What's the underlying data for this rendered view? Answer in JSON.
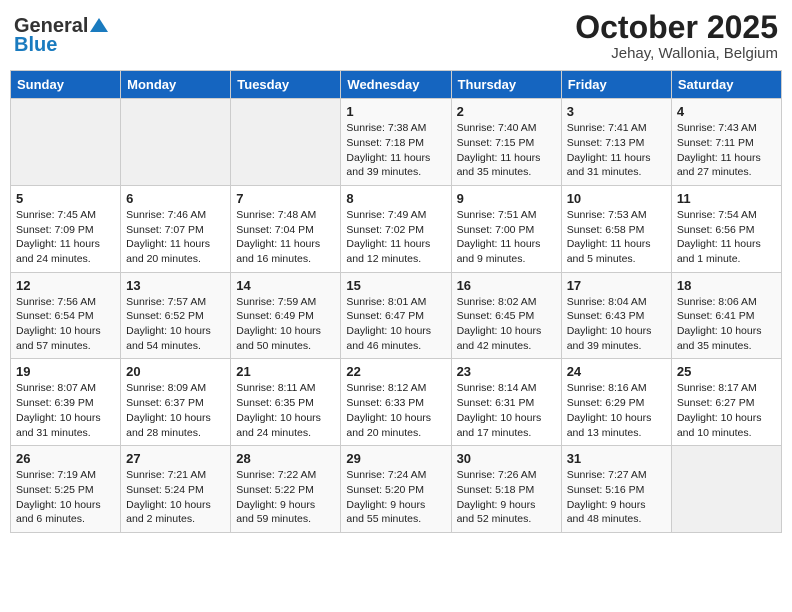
{
  "header": {
    "logo_general": "General",
    "logo_blue": "Blue",
    "month": "October 2025",
    "location": "Jehay, Wallonia, Belgium"
  },
  "weekdays": [
    "Sunday",
    "Monday",
    "Tuesday",
    "Wednesday",
    "Thursday",
    "Friday",
    "Saturday"
  ],
  "weeks": [
    [
      {
        "day": "",
        "info": ""
      },
      {
        "day": "",
        "info": ""
      },
      {
        "day": "",
        "info": ""
      },
      {
        "day": "1",
        "info": "Sunrise: 7:38 AM\nSunset: 7:18 PM\nDaylight: 11 hours\nand 39 minutes."
      },
      {
        "day": "2",
        "info": "Sunrise: 7:40 AM\nSunset: 7:15 PM\nDaylight: 11 hours\nand 35 minutes."
      },
      {
        "day": "3",
        "info": "Sunrise: 7:41 AM\nSunset: 7:13 PM\nDaylight: 11 hours\nand 31 minutes."
      },
      {
        "day": "4",
        "info": "Sunrise: 7:43 AM\nSunset: 7:11 PM\nDaylight: 11 hours\nand 27 minutes."
      }
    ],
    [
      {
        "day": "5",
        "info": "Sunrise: 7:45 AM\nSunset: 7:09 PM\nDaylight: 11 hours\nand 24 minutes."
      },
      {
        "day": "6",
        "info": "Sunrise: 7:46 AM\nSunset: 7:07 PM\nDaylight: 11 hours\nand 20 minutes."
      },
      {
        "day": "7",
        "info": "Sunrise: 7:48 AM\nSunset: 7:04 PM\nDaylight: 11 hours\nand 16 minutes."
      },
      {
        "day": "8",
        "info": "Sunrise: 7:49 AM\nSunset: 7:02 PM\nDaylight: 11 hours\nand 12 minutes."
      },
      {
        "day": "9",
        "info": "Sunrise: 7:51 AM\nSunset: 7:00 PM\nDaylight: 11 hours\nand 9 minutes."
      },
      {
        "day": "10",
        "info": "Sunrise: 7:53 AM\nSunset: 6:58 PM\nDaylight: 11 hours\nand 5 minutes."
      },
      {
        "day": "11",
        "info": "Sunrise: 7:54 AM\nSunset: 6:56 PM\nDaylight: 11 hours\nand 1 minute."
      }
    ],
    [
      {
        "day": "12",
        "info": "Sunrise: 7:56 AM\nSunset: 6:54 PM\nDaylight: 10 hours\nand 57 minutes."
      },
      {
        "day": "13",
        "info": "Sunrise: 7:57 AM\nSunset: 6:52 PM\nDaylight: 10 hours\nand 54 minutes."
      },
      {
        "day": "14",
        "info": "Sunrise: 7:59 AM\nSunset: 6:49 PM\nDaylight: 10 hours\nand 50 minutes."
      },
      {
        "day": "15",
        "info": "Sunrise: 8:01 AM\nSunset: 6:47 PM\nDaylight: 10 hours\nand 46 minutes."
      },
      {
        "day": "16",
        "info": "Sunrise: 8:02 AM\nSunset: 6:45 PM\nDaylight: 10 hours\nand 42 minutes."
      },
      {
        "day": "17",
        "info": "Sunrise: 8:04 AM\nSunset: 6:43 PM\nDaylight: 10 hours\nand 39 minutes."
      },
      {
        "day": "18",
        "info": "Sunrise: 8:06 AM\nSunset: 6:41 PM\nDaylight: 10 hours\nand 35 minutes."
      }
    ],
    [
      {
        "day": "19",
        "info": "Sunrise: 8:07 AM\nSunset: 6:39 PM\nDaylight: 10 hours\nand 31 minutes."
      },
      {
        "day": "20",
        "info": "Sunrise: 8:09 AM\nSunset: 6:37 PM\nDaylight: 10 hours\nand 28 minutes."
      },
      {
        "day": "21",
        "info": "Sunrise: 8:11 AM\nSunset: 6:35 PM\nDaylight: 10 hours\nand 24 minutes."
      },
      {
        "day": "22",
        "info": "Sunrise: 8:12 AM\nSunset: 6:33 PM\nDaylight: 10 hours\nand 20 minutes."
      },
      {
        "day": "23",
        "info": "Sunrise: 8:14 AM\nSunset: 6:31 PM\nDaylight: 10 hours\nand 17 minutes."
      },
      {
        "day": "24",
        "info": "Sunrise: 8:16 AM\nSunset: 6:29 PM\nDaylight: 10 hours\nand 13 minutes."
      },
      {
        "day": "25",
        "info": "Sunrise: 8:17 AM\nSunset: 6:27 PM\nDaylight: 10 hours\nand 10 minutes."
      }
    ],
    [
      {
        "day": "26",
        "info": "Sunrise: 7:19 AM\nSunset: 5:25 PM\nDaylight: 10 hours\nand 6 minutes."
      },
      {
        "day": "27",
        "info": "Sunrise: 7:21 AM\nSunset: 5:24 PM\nDaylight: 10 hours\nand 2 minutes."
      },
      {
        "day": "28",
        "info": "Sunrise: 7:22 AM\nSunset: 5:22 PM\nDaylight: 9 hours\nand 59 minutes."
      },
      {
        "day": "29",
        "info": "Sunrise: 7:24 AM\nSunset: 5:20 PM\nDaylight: 9 hours\nand 55 minutes."
      },
      {
        "day": "30",
        "info": "Sunrise: 7:26 AM\nSunset: 5:18 PM\nDaylight: 9 hours\nand 52 minutes."
      },
      {
        "day": "31",
        "info": "Sunrise: 7:27 AM\nSunset: 5:16 PM\nDaylight: 9 hours\nand 48 minutes."
      },
      {
        "day": "",
        "info": ""
      }
    ]
  ]
}
